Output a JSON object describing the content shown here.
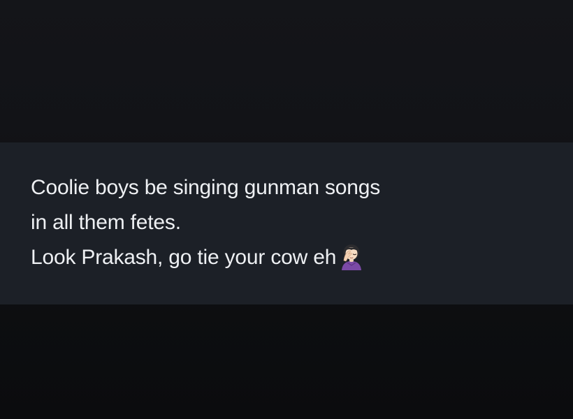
{
  "tweet": {
    "lines": [
      "Coolie boys be singing gunman songs",
      "in all them fetes.",
      "Look Prakash, go tie your cow eh"
    ],
    "trailing_emoji": "woman-facepalming-icon"
  },
  "colors": {
    "background": "#121317",
    "band": "#1c2027",
    "text": "#eef0f3"
  }
}
